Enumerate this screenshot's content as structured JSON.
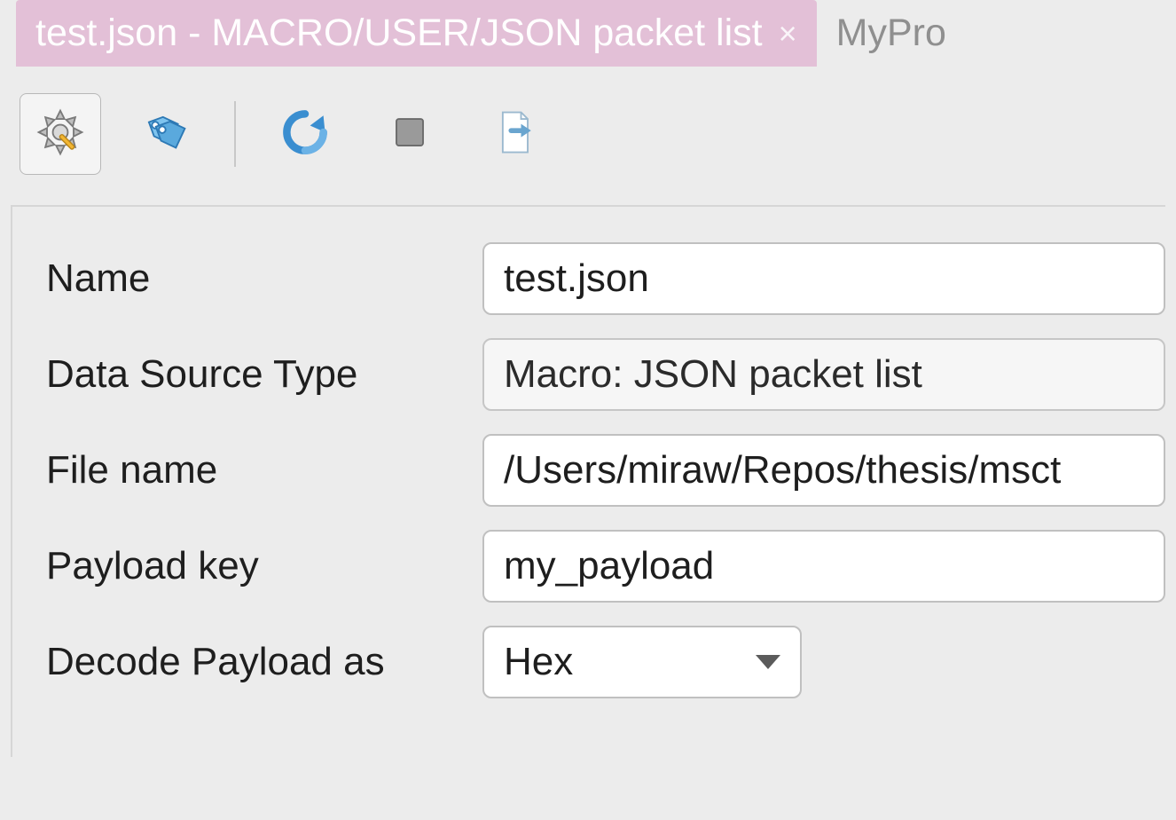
{
  "tabs": {
    "active": {
      "label": "test.json - MACRO/USER/JSON packet list",
      "close_symbol": "×"
    },
    "inactive": {
      "label": "MyPro"
    }
  },
  "toolbar": {
    "gear_icon": "gear-icon",
    "tag_icon": "tag-icon",
    "refresh_icon": "refresh-icon",
    "stop_icon": "stop-icon",
    "export_icon": "export-icon"
  },
  "form": {
    "name": {
      "label": "Name",
      "value": "test.json"
    },
    "data_source_type": {
      "label": "Data Source Type",
      "value": "Macro: JSON packet list"
    },
    "file_name": {
      "label": "File name",
      "value": "/Users/miraw/Repos/thesis/msct"
    },
    "payload_key": {
      "label": "Payload key",
      "value": "my_payload"
    },
    "decode_payload_as": {
      "label": "Decode Payload as",
      "value": "Hex"
    }
  }
}
